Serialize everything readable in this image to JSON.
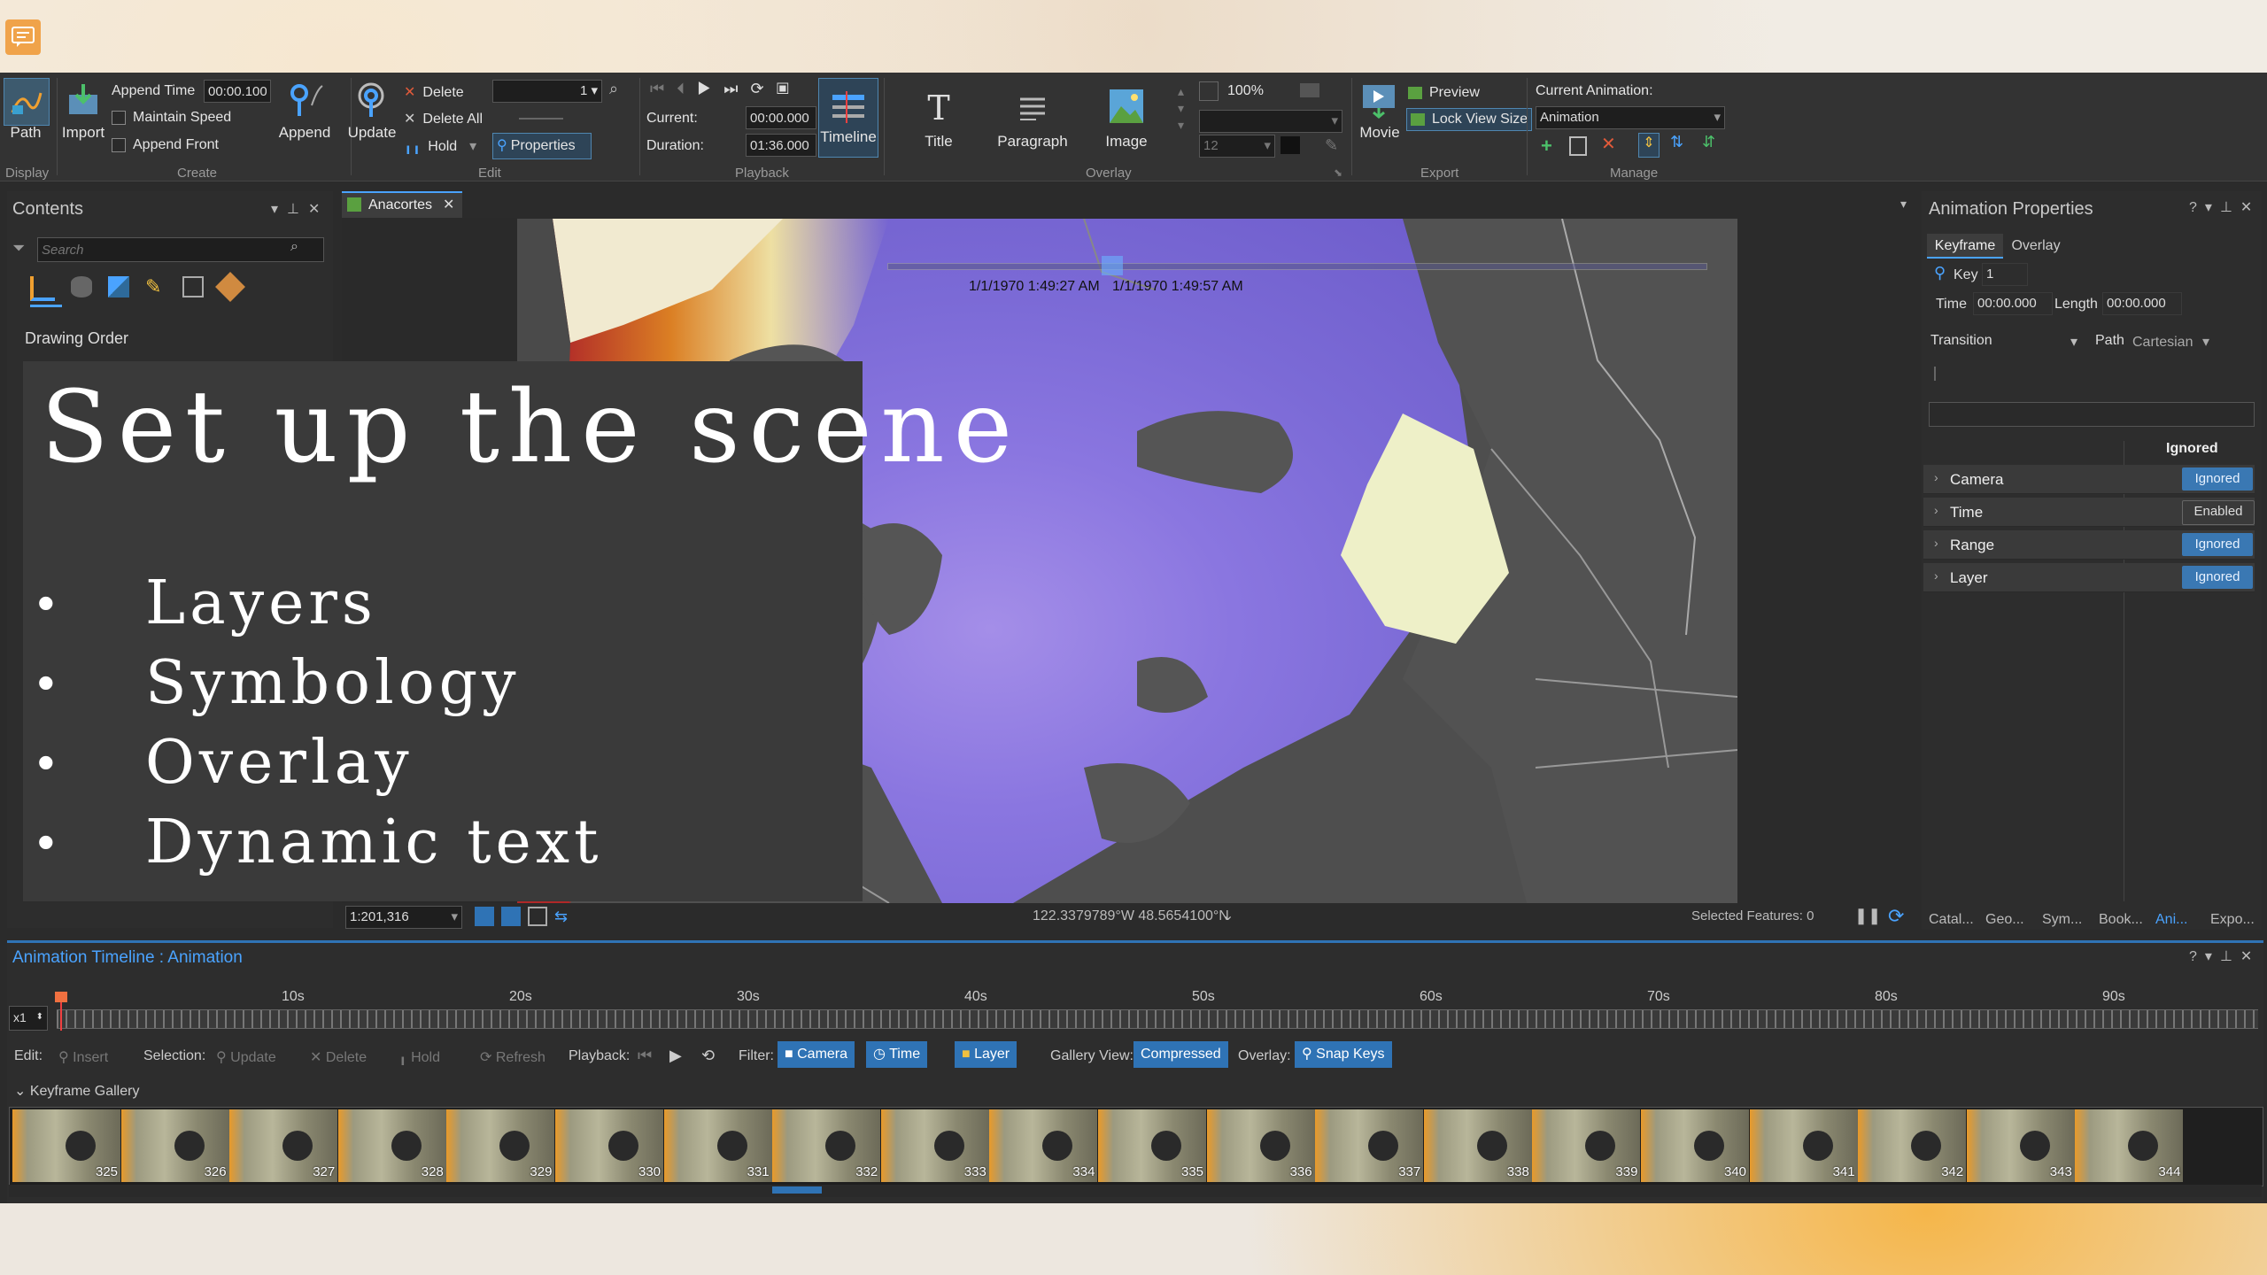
{
  "ribbon": {
    "display": {
      "path_label": "Path",
      "group": "Display"
    },
    "create": {
      "import_label": "Import",
      "append_time_label": "Append Time",
      "append_time_value": "00:00.100",
      "maintain_speed_label": "Maintain Speed",
      "append_front_label": "Append Front",
      "append_label": "Append",
      "group": "Create"
    },
    "edit": {
      "update_label": "Update",
      "delete_label": "Delete",
      "delete_all_label": "Delete All",
      "hold_label": "Hold",
      "properties_label": "Properties",
      "keyframe_index": "1",
      "group": "Edit"
    },
    "playback": {
      "current_label": "Current:",
      "current_value": "00:00.000",
      "duration_label": "Duration:",
      "duration_value": "01:36.000",
      "timeline_label": "Timeline",
      "group": "Playback"
    },
    "overlay": {
      "title_label": "Title",
      "paragraph_label": "Paragraph",
      "image_label": "Image",
      "zoom_value": "100%",
      "font_size_value": "12",
      "group": "Overlay"
    },
    "export": {
      "movie_label": "Movie",
      "preview_label": "Preview",
      "lock_view_size_label": "Lock View Size",
      "group": "Export"
    },
    "manage": {
      "current_animation_label": "Current Animation:",
      "current_animation_value": "Animation",
      "group": "Manage"
    }
  },
  "contents": {
    "title": "Contents",
    "search_placeholder": "Search",
    "drawing_order_label": "Drawing Order"
  },
  "map_view": {
    "tab_label": "Anacortes",
    "time_start": "1/1/1970 1:49:27 AM",
    "time_end": "1/1/1970 1:49:57 AM",
    "scale": "1:201,316",
    "coordinates": "122.3379789°W 48.5654100°N",
    "selected_features": "Selected Features: 0"
  },
  "slide": {
    "title": "Set up the scene",
    "bullets": [
      "Layers",
      "Symbology",
      "Overlay",
      "Dynamic text"
    ],
    "bullet_symbol": "•"
  },
  "animation_properties": {
    "title": "Animation Properties",
    "tabs": [
      "Keyframe",
      "Overlay"
    ],
    "key_label": "Key",
    "key_value": "1",
    "time_label": "Time",
    "time_value": "00:00.000",
    "length_label": "Length",
    "length_value": "00:00.000",
    "transition_label": "Transition",
    "path_label": "Path",
    "path_value": "Cartesian",
    "column_header": "Ignored",
    "rows": [
      {
        "label": "Camera",
        "state": "Ignored"
      },
      {
        "label": "Time",
        "state": "Enabled"
      },
      {
        "label": "Range",
        "state": "Ignored"
      },
      {
        "label": "Layer",
        "state": "Ignored"
      }
    ],
    "footer_tabs": [
      "Catal...",
      "Geo...",
      "Sym...",
      "Book...",
      "Ani...",
      "Expo..."
    ]
  },
  "timeline": {
    "title": "Animation Timeline : Animation",
    "speed_value": "x1",
    "ticks": [
      "10s",
      "20s",
      "30s",
      "40s",
      "50s",
      "60s",
      "70s",
      "80s",
      "90s"
    ],
    "edit_label": "Edit:",
    "insert_label": "Insert",
    "selection_label": "Selection:",
    "update_label": "Update",
    "delete_label": "Delete",
    "hold_label": "Hold",
    "refresh_label": "Refresh",
    "playback_label": "Playback:",
    "filter_label": "Filter:",
    "filters": [
      "Camera",
      "Time",
      "Layer"
    ],
    "gallery_view_label": "Gallery View:",
    "gallery_view_value": "Compressed",
    "overlay_label": "Overlay:",
    "snap_keys_label": "Snap Keys",
    "keyframe_gallery_label": "Keyframe Gallery",
    "keyframes": [
      "325",
      "326",
      "327",
      "328",
      "329",
      "330",
      "331",
      "332",
      "333",
      "334",
      "335",
      "336",
      "337",
      "338",
      "339",
      "340",
      "341",
      "342",
      "343",
      "344"
    ]
  },
  "colors": {
    "accent": "#3a78b3",
    "panel_bg": "#2d2d2d",
    "ribbon_bg": "#333333",
    "timeline_title": "#4aa3ff"
  }
}
